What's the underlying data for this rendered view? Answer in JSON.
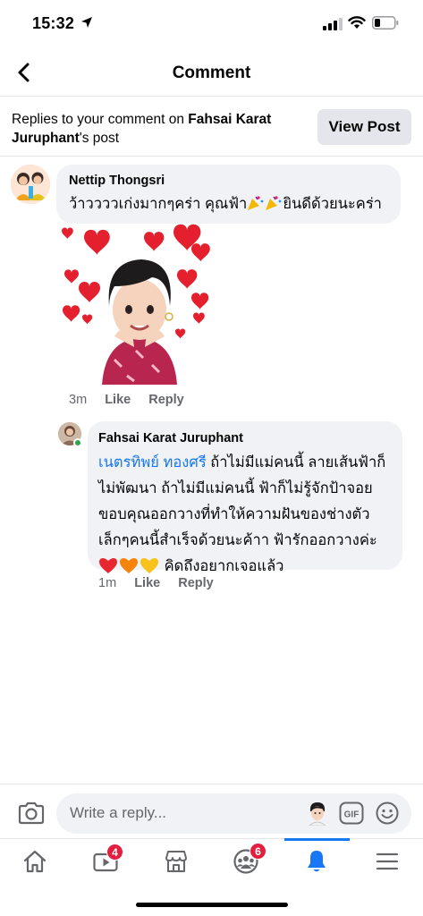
{
  "status_bar": {
    "time": "15:32"
  },
  "header": {
    "title": "Comment"
  },
  "banner": {
    "prefix": "Replies to your comment on ",
    "post_owner": "Fahsai Karat Juruphant",
    "suffix": "'s post",
    "view_post_label": "View Post"
  },
  "comment": {
    "author": "Nettip Thongsri",
    "text_part1": "ว้าวววว​เก่งมากๆคร่า คุณฟ้า",
    "text_part2": "ยินดีด้วยนะคร่า",
    "time": "3m",
    "like_label": "Like",
    "reply_label": "Reply"
  },
  "reply": {
    "author": "Fahsai Karat Juruphant",
    "mention": "เนตรทิพย์ ทองศรี",
    "text": " ถ้าไม่มีแม่คนนี้ ลายเส้นฟ้าก็ไม่พัฒนา ถ้าไม่มีแม่คนนี้ ฟ้าก็ไม่รู้จักป้าจอย ขอบคุณออกวางที่ทำให้ความฝันของช่างตัวเล็กๆคนนี้สำเร็จด้วยนะค้าา ฟ้ารักออกวางค่ะ ",
    "text_end": " คิดถึงอยากเจอแล้ว",
    "time": "1m",
    "like_label": "Like",
    "reply_label": "Reply"
  },
  "compose": {
    "placeholder": "Write a reply..."
  },
  "tabs": {
    "watch_badge": "4",
    "groups_badge": "6",
    "active": "notifications"
  },
  "colors": {
    "accent": "#1877f2",
    "badge": "#e41e3f",
    "bubble": "#f0f2f5"
  }
}
